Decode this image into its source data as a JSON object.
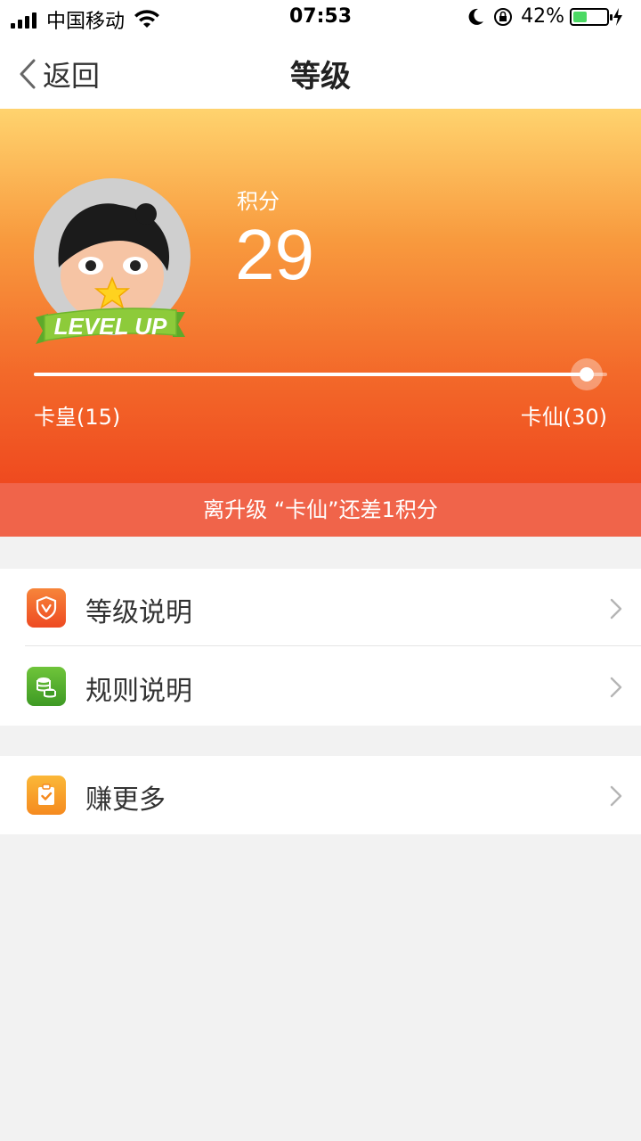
{
  "status_bar": {
    "carrier": "中国移动",
    "time": "07:53",
    "battery_pct": "42%",
    "battery_level": 0.42
  },
  "nav": {
    "back_label": "返回",
    "title": "等级"
  },
  "hero": {
    "badge_text": "LEVEL UP",
    "points_label": "积分",
    "points_value": "29",
    "progress": 0.965,
    "current_level": "卡皇(15)",
    "next_level": "卡仙(30)",
    "upgrade_hint": "离升级 “卡仙”还差1积分"
  },
  "menu": {
    "items": [
      {
        "label": "等级说明",
        "icon": "shield-icon",
        "color": "#f05a28"
      },
      {
        "label": "规则说明",
        "icon": "coins-icon",
        "color": "#4caf2a"
      },
      {
        "label": "赚更多",
        "icon": "clipboard-check-icon",
        "color": "#f7a425"
      }
    ]
  }
}
